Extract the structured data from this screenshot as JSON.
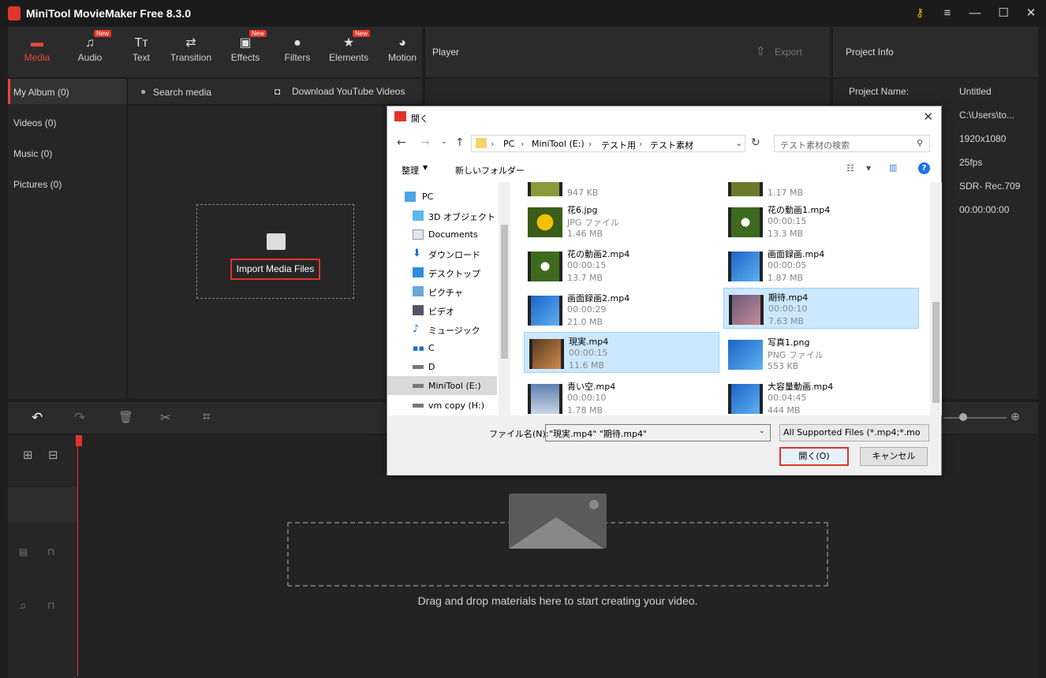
{
  "app": {
    "title": "MiniTool MovieMaker Free 8.3.0"
  },
  "toolbar": {
    "tools": [
      {
        "label": "Media",
        "new": false
      },
      {
        "label": "Audio",
        "new": true
      },
      {
        "label": "Text",
        "new": false
      },
      {
        "label": "Transition",
        "new": false
      },
      {
        "label": "Effects",
        "new": true
      },
      {
        "label": "Filters",
        "new": false
      },
      {
        "label": "Elements",
        "new": true
      },
      {
        "label": "Motion",
        "new": false
      }
    ],
    "new_badge": "New"
  },
  "player": {
    "title": "Player",
    "export_label": "Export"
  },
  "project_info": {
    "title": "Project Info",
    "name_label": "Project Name:",
    "name": "Untitled",
    "path": "C:\\Users\\to...",
    "resolution": "1920x1080",
    "fps": "25fps",
    "color": "SDR- Rec.709",
    "duration": "00:00:00:00"
  },
  "sidebar": {
    "items": [
      "My Album (0)",
      "Videos (0)",
      "Music (0)",
      "Pictures (0)"
    ]
  },
  "media": {
    "search_placeholder": "Search media",
    "download_label": "Download YouTube Videos",
    "import_label": "Import Media Files"
  },
  "timeline": {
    "drop_text": "Drag and drop materials here to start creating your video."
  },
  "dialog": {
    "title": "開く",
    "breadcrumb": [
      "PC",
      "MiniTool (E:)",
      "テスト用",
      "テスト素材"
    ],
    "search_placeholder": "テスト素材の検索",
    "organize_label": "整理",
    "new_folder_label": "新しいフォルダー",
    "nav": [
      "PC",
      "3D オブジェクト",
      "Documents",
      "ダウンロード",
      "デスクトップ",
      "ピクチャ",
      "ビデオ",
      "ミュージック",
      "C",
      "D",
      "MiniTool (E:)",
      "vm copy (H:)"
    ],
    "files": [
      {
        "name": "",
        "sub": "",
        "size": "947 KB",
        "selected": false
      },
      {
        "name": "",
        "sub": "",
        "size": "1.17 MB",
        "selected": false
      },
      {
        "name": "花6.jpg",
        "sub": "JPG ファイル",
        "size": "1.46 MB",
        "selected": false
      },
      {
        "name": "花の動画1.mp4",
        "sub": "00:00:15",
        "size": "13.3 MB",
        "selected": false
      },
      {
        "name": "花の動画2.mp4",
        "sub": "00:00:15",
        "size": "13.7 MB",
        "selected": false
      },
      {
        "name": "画面録画.mp4",
        "sub": "00:00:05",
        "size": "1.87 MB",
        "selected": false
      },
      {
        "name": "画面録画2.mp4",
        "sub": "00:00:29",
        "size": "21.0 MB",
        "selected": false
      },
      {
        "name": "期待.mp4",
        "sub": "00:00:10",
        "size": "7.63 MB",
        "selected": true
      },
      {
        "name": "現実.mp4",
        "sub": "00:00:15",
        "size": "11.6 MB",
        "selected": true
      },
      {
        "name": "写真1.png",
        "sub": "PNG ファイル",
        "size": "553 KB",
        "selected": false
      },
      {
        "name": "青い空.mp4",
        "sub": "00:00:10",
        "size": "1.78 MB",
        "selected": false
      },
      {
        "name": "大容量動画.mp4",
        "sub": "00:04:45",
        "size": "444 MB",
        "selected": false
      }
    ],
    "filename_label": "ファイル名(N):",
    "filename_value": "\"現実.mp4\" \"期待.mp4\"",
    "filetype_value": "All Supported Files (*.mp4;*.mo",
    "open_label": "開く(O)",
    "cancel_label": "キャンセル"
  }
}
